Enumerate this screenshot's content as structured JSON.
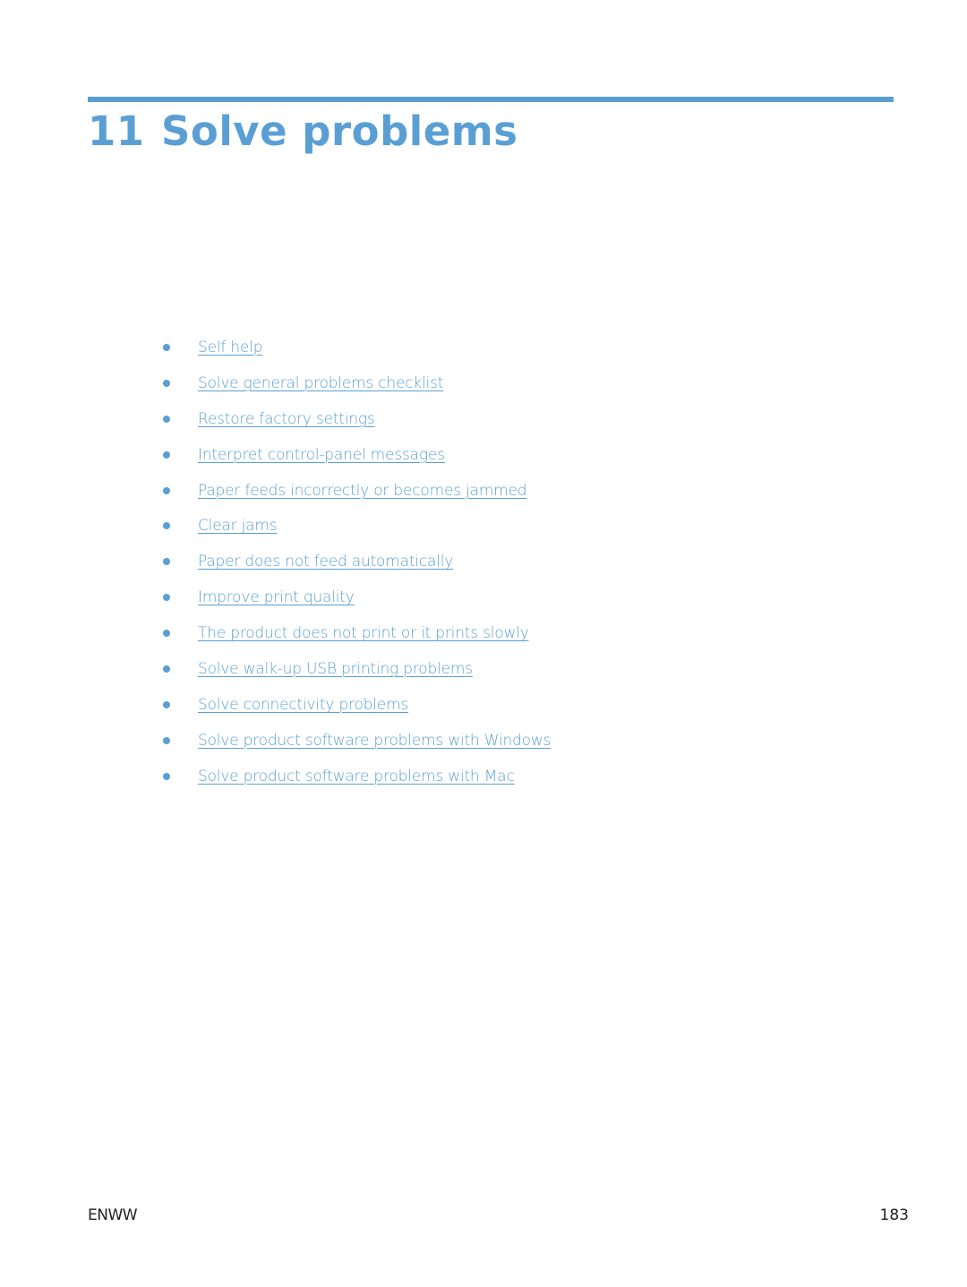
{
  "chapter": {
    "number": "11",
    "title": "Solve problems",
    "accent_color": "#5a9fd4"
  },
  "toc": {
    "items": [
      {
        "label": "Self help"
      },
      {
        "label": "Solve general problems checklist"
      },
      {
        "label": "Restore factory settings"
      },
      {
        "label": "Interpret control-panel messages"
      },
      {
        "label": "Paper feeds incorrectly or becomes jammed"
      },
      {
        "label": "Clear jams"
      },
      {
        "label": "Paper does not feed automatically"
      },
      {
        "label": "Improve print quality"
      },
      {
        "label": "The product does not print or it prints slowly"
      },
      {
        "label": "Solve walk-up USB printing problems"
      },
      {
        "label": "Solve connectivity problems"
      },
      {
        "label": "Solve product software problems with Windows"
      },
      {
        "label": "Solve product software problems with Mac"
      }
    ]
  },
  "footer": {
    "left": "ENWW",
    "page_number": "183"
  }
}
